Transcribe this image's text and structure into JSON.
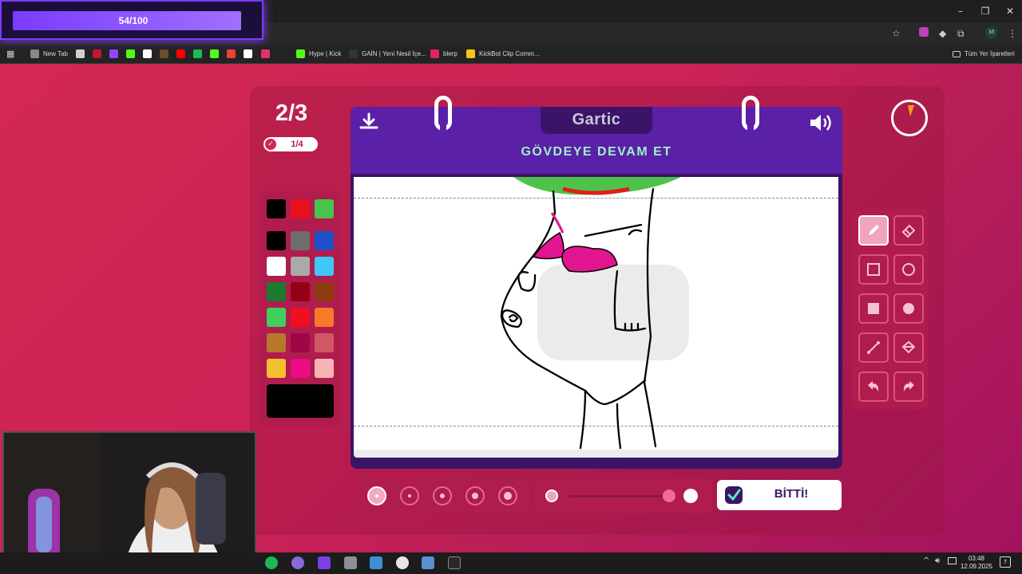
{
  "overlay": {
    "goal_progress": "54/100"
  },
  "window_controls": {
    "minimize": "–",
    "restore": "❐",
    "close": "✕"
  },
  "bookmarks": [
    {
      "label": "New Tab",
      "color": "#888888"
    },
    {
      "label": "",
      "color": "#d0d0d0"
    },
    {
      "label": "",
      "color": "#c0172d"
    },
    {
      "label": "",
      "color": "#9146ff"
    },
    {
      "label": "",
      "color": "#53fc18"
    },
    {
      "label": "",
      "color": "#ffffff"
    },
    {
      "label": "",
      "color": "#6b4f2a"
    },
    {
      "label": "",
      "color": "#ff0000"
    },
    {
      "label": "",
      "color": "#1db954"
    },
    {
      "label": "",
      "color": "#53fc18"
    },
    {
      "label": "",
      "color": "#ea4335"
    },
    {
      "label": "",
      "color": "#ffffff"
    },
    {
      "label": "",
      "color": "#e1306c"
    },
    {
      "label": "Hype | Kick",
      "color": "#53fc18"
    },
    {
      "label": "GAİN | Yeni Nesil İçe...",
      "color": "#333333"
    },
    {
      "label": "blerp",
      "color": "#e0245e"
    },
    {
      "label": "KickBot Clip Comm...",
      "color": "#f5c518"
    }
  ],
  "all_bookmarks": "Tüm Yer İşaretleri",
  "profile_initial": "M",
  "game": {
    "round": "2/3",
    "completed": "1/4",
    "logo": "Gartic",
    "instruction": "GÖVDEYE DEVAM ET",
    "done_label": "BİTTİ!",
    "timer_fraction": 0.06,
    "colors": {
      "accent_purple": "#5a20a8",
      "instruction_green": "#9ef2c4",
      "background_red": "#d22852"
    },
    "palette": [
      "#000000",
      "#e8101c",
      "#47c44b",
      "#000000",
      "#6e6e6e",
      "#2050c8",
      "#ffffff",
      "#aaaaaa",
      "#3ec8f5",
      "#1e7a2e",
      "#960014",
      "#8e3a10",
      "#3ed05a",
      "#ee1020",
      "#f57b28",
      "#b8782a",
      "#a00646",
      "#d05862",
      "#f5c030",
      "#ec0c88",
      "#f6b4b4"
    ],
    "selected_color": "#000000",
    "tools": [
      "pencil-icon",
      "eraser-icon",
      "rectangle-outline-icon",
      "ellipse-outline-icon",
      "rectangle-filled-icon",
      "ellipse-filled-icon",
      "line-icon",
      "fill-bucket-icon",
      "undo-icon",
      "redo-icon"
    ],
    "active_tool": "pencil-icon",
    "brush_sizes": 5,
    "selected_brush_size": 1,
    "opacity": 1.0
  },
  "taskbar": {
    "time": "03:48",
    "date": "12.09.2025",
    "notification_count": "7"
  }
}
